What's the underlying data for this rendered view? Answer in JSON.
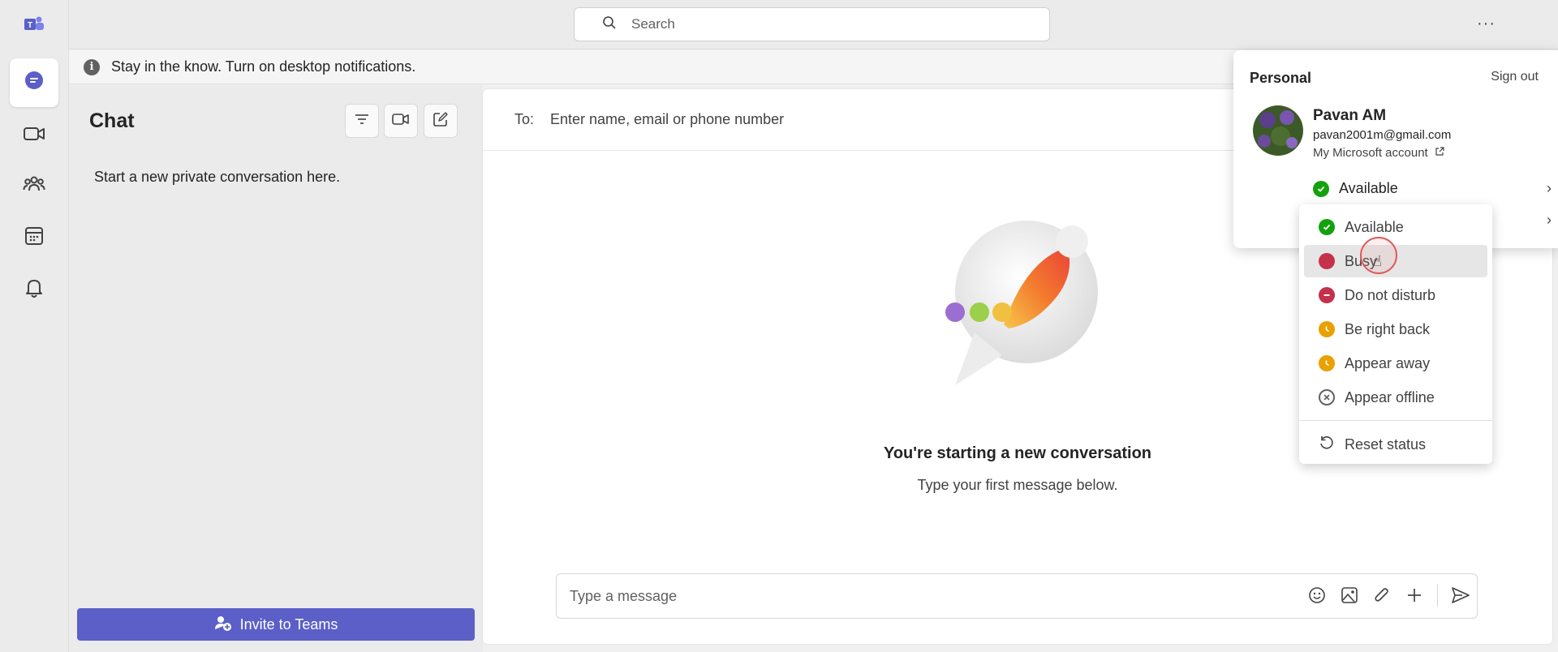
{
  "search": {
    "placeholder": "Search"
  },
  "banner": {
    "text": "Stay in the know. Turn on desktop notifications."
  },
  "chat": {
    "title": "Chat",
    "empty_text": "Start a new private conversation here.",
    "invite_label": "Invite to Teams"
  },
  "main": {
    "to_label": "To:",
    "to_placeholder": "Enter name, email or phone number",
    "heading": "You're starting a new conversation",
    "subheading": "Type your first message below.",
    "compose_placeholder": "Type a message"
  },
  "profile": {
    "section": "Personal",
    "sign_out": "Sign out",
    "name": "Pavan AM",
    "email": "pavan2001m@gmail.com",
    "account_link": "My Microsoft account",
    "current_status": "Available"
  },
  "status_menu": {
    "items": [
      {
        "label": "Available",
        "icon": "available-icon",
        "color": "#13a10e"
      },
      {
        "label": "Busy",
        "icon": "busy-icon",
        "color": "#c4314b"
      },
      {
        "label": "Do not disturb",
        "icon": "do-not-disturb-icon",
        "color": "#c4314b"
      },
      {
        "label": "Be right back",
        "icon": "clock-icon",
        "color": "#e8a100"
      },
      {
        "label": "Appear away",
        "icon": "clock-icon",
        "color": "#e8a100"
      },
      {
        "label": "Appear offline",
        "icon": "offline-icon",
        "color": "#616161"
      }
    ],
    "reset_label": "Reset status",
    "hovered": "Busy"
  },
  "colors": {
    "brand": "#5b5fc7",
    "available": "#13a10e",
    "busy": "#c4314b",
    "away": "#e8a100"
  }
}
